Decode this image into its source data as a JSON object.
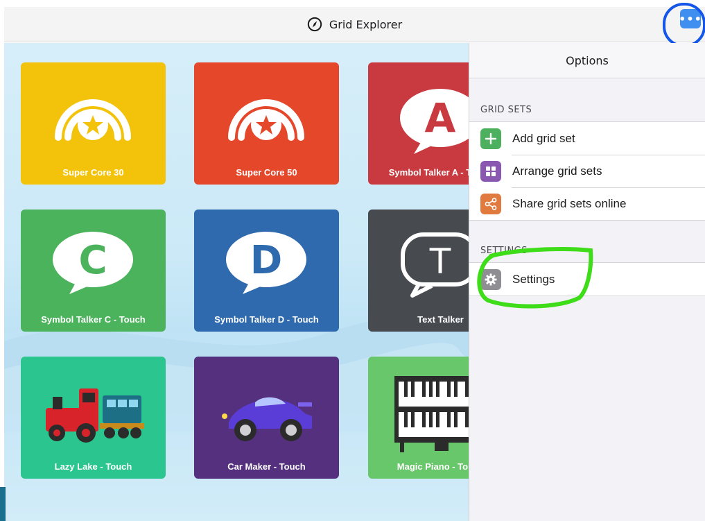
{
  "app": {
    "title": "Grid Explorer",
    "menu_label": "•••"
  },
  "tiles": [
    {
      "label": "Super Core 30",
      "color": "#f3c30c",
      "icon": "super-core-icon"
    },
    {
      "label": "Super Core 50",
      "color": "#e5472a",
      "icon": "super-core-icon"
    },
    {
      "label": "Symbol Talker A - Touch",
      "color": "#c93a40",
      "icon": "speech-bubble-a-icon",
      "glyph": "A"
    },
    {
      "label": "Symbol Talker C - Touch",
      "color": "#4bb35b",
      "icon": "speech-bubble-c-icon",
      "glyph": "C"
    },
    {
      "label": "Symbol Talker D - Touch",
      "color": "#2e6aad",
      "icon": "speech-bubble-d-icon",
      "glyph": "D"
    },
    {
      "label": "Text Talker",
      "color": "#474b50",
      "icon": "speech-bubble-t-icon",
      "glyph": "T"
    },
    {
      "label": "Lazy Lake - Touch",
      "color": "#2bc68f",
      "icon": "train-icon"
    },
    {
      "label": "Car Maker - Touch",
      "color": "#55307f",
      "icon": "car-icon"
    },
    {
      "label": "Magic Piano - Touch",
      "color": "#68c76a",
      "icon": "piano-icon"
    }
  ],
  "panel": {
    "title": "Options",
    "grid_sets_header": "GRID SETS",
    "grid_sets_items": [
      {
        "label": "Add grid set",
        "color": "#4cb05e",
        "icon": "plus-icon"
      },
      {
        "label": "Arrange grid sets",
        "color": "#8a57b1",
        "icon": "arrange-icon"
      },
      {
        "label": "Share grid sets online",
        "color": "#e07a3e",
        "icon": "share-icon"
      }
    ],
    "settings_header": "SETTINGS",
    "settings_items": [
      {
        "label": "Settings",
        "color": "#8e8e93",
        "icon": "gear-icon"
      }
    ]
  }
}
